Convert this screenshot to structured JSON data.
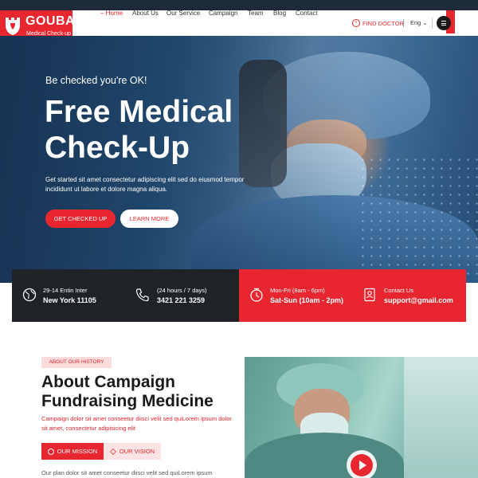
{
  "brand": {
    "name": "GOUBA",
    "tagline": "Medical Check-up",
    "color": "#e8262f"
  },
  "nav": {
    "items": [
      {
        "label": "Home",
        "active": true
      },
      {
        "label": "About Us"
      },
      {
        "label": "Our Service"
      },
      {
        "label": "Campaign"
      },
      {
        "label": "Team"
      },
      {
        "label": "Blog"
      },
      {
        "label": "Contact"
      }
    ],
    "find_doctor": "FIND DOCTOR",
    "language": "Eng",
    "menu_icon": "hamburger-icon"
  },
  "hero": {
    "kicker": "Be checked you're OK!",
    "title": "Free Medical Check-Up",
    "text": "Get started sit amet consectetur adipiscing elit sed do eiusmod tempor incididunt ut labore et dolore magna aliqua.",
    "primary_button": "GET CHECKED UP",
    "secondary_button": "LEARN MORE"
  },
  "info": [
    {
      "icon": "globe-icon",
      "line1": "29-14 Entin Inter",
      "line2": "New York 11105"
    },
    {
      "icon": "phone-icon",
      "line1": "(24 hours / 7 days)",
      "line2": "3421 221 3259"
    },
    {
      "icon": "clock-icon",
      "line1": "Mon-Fri (8am - 6pm)",
      "line2": "Sat-Sun (10am - 2pm)"
    },
    {
      "icon": "contact-card-icon",
      "line1": "Contact Us",
      "line2": "support@gmail.com"
    }
  ],
  "about": {
    "badge": "ABOUT OUR HISTORY",
    "title": "About Campaign Fundraising Medicine",
    "lead": "Campaign dolor sit amet conseetur diisci velit sed quiLorem ipsum dolor sit amet, consectetur adipisicing elit",
    "tab_mission": "OUR MISSION",
    "tab_vision": "OUR VISION",
    "body": "Our plan dolor sit amet conseetur diisci velit sed quiLorem ipsum"
  }
}
